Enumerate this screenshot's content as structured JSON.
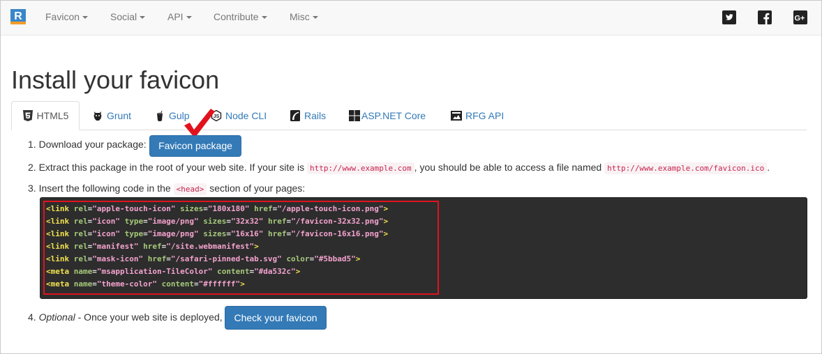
{
  "navbar": {
    "logo_letter": "R",
    "items": [
      {
        "label": "Favicon"
      },
      {
        "label": "Social"
      },
      {
        "label": "API"
      },
      {
        "label": "Contribute"
      },
      {
        "label": "Misc"
      }
    ],
    "social_icons": [
      "twitter-icon",
      "facebook-icon",
      "google-plus-icon"
    ]
  },
  "page": {
    "title": "Install your favicon"
  },
  "tabs": [
    {
      "label": "HTML5",
      "icon": "html5-icon",
      "active": true
    },
    {
      "label": "Grunt",
      "icon": "grunt-icon"
    },
    {
      "label": "Gulp",
      "icon": "gulp-icon"
    },
    {
      "label": "Node CLI",
      "icon": "nodejs-icon"
    },
    {
      "label": "Rails",
      "icon": "rails-icon"
    },
    {
      "label": "ASP.NET Core",
      "icon": "windows-icon"
    },
    {
      "label": "RFG API",
      "icon": "rfg-api-icon"
    }
  ],
  "steps": {
    "s1_text": "1. Download your package:",
    "s1_button": "Favicon package",
    "s2_prefix": "2. Extract this package in the root of your web site. If your site is",
    "s2_code1": "http://www.example.com",
    "s2_middle": ", you should be able to access a file named",
    "s2_code2": "http://www.example.com/favicon.ico",
    "s2_suffix": ".",
    "s3_prefix": "3. Insert the following code in the",
    "s3_code": "<head>",
    "s3_suffix": "section of your pages:",
    "s4_num": "4.",
    "s4_optional": "Optional",
    "s4_text": "- Once your web site is deployed,",
    "s4_button": "Check your favicon"
  },
  "code_lines": [
    "<link rel=\"apple-touch-icon\" sizes=\"180x180\" href=\"/apple-touch-icon.png\">",
    "<link rel=\"icon\" type=\"image/png\" sizes=\"32x32\" href=\"/favicon-32x32.png\">",
    "<link rel=\"icon\" type=\"image/png\" sizes=\"16x16\" href=\"/favicon-16x16.png\">",
    "<link rel=\"manifest\" href=\"/site.webmanifest\">",
    "<link rel=\"mask-icon\" href=\"/safari-pinned-tab.svg\" color=\"#5bbad5\">",
    "<meta name=\"msapplication-TileColor\" content=\"#da532c\">",
    "<meta name=\"theme-color\" content=\"#ffffff\">"
  ],
  "colors": {
    "brand_blue": "#337ab7",
    "highlight_red": "#e1121d",
    "code_bg": "#2d2d2d"
  }
}
